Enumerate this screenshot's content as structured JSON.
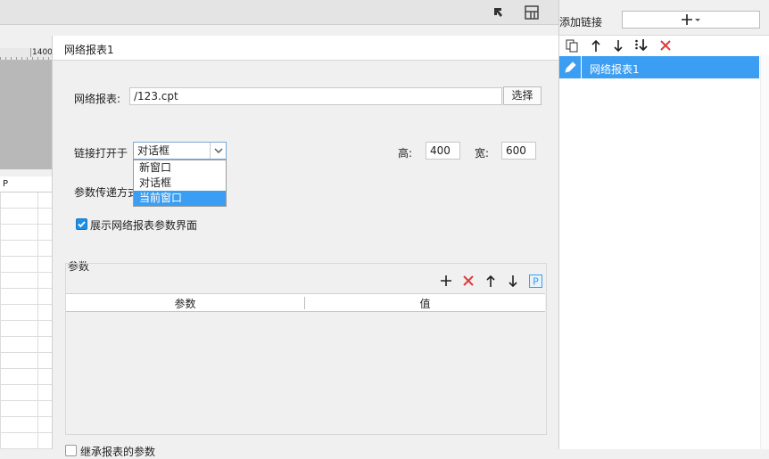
{
  "dialog": {
    "title": "网络报表1",
    "report_label": "网络报表:",
    "report_value": "/123.cpt",
    "choose_button": "选择",
    "open_in_label": "链接打开于",
    "open_in_value": "对话框",
    "open_in_options": [
      "新窗口",
      "对话框",
      "当前窗口"
    ],
    "open_in_highlighted": "当前窗口",
    "height_label": "高:",
    "height_value": "400",
    "width_label": "宽:",
    "width_value": "600",
    "param_method_label": "参数传递方式",
    "show_params_label": "展示网络报表参数界面",
    "params_group_title": "参数",
    "params_columns": [
      "参数",
      "值"
    ],
    "bottom_checkbox_label": "继承报表的参数"
  },
  "right_panel": {
    "add_link_label": "添加链接",
    "links": [
      "网络报表1"
    ]
  },
  "background": {
    "ruler_mark": "1400",
    "column_header": "P"
  },
  "colors": {
    "accent": "#3c9ef3",
    "delete": "#e03b3b",
    "checkbox": "#1f8fe6"
  }
}
